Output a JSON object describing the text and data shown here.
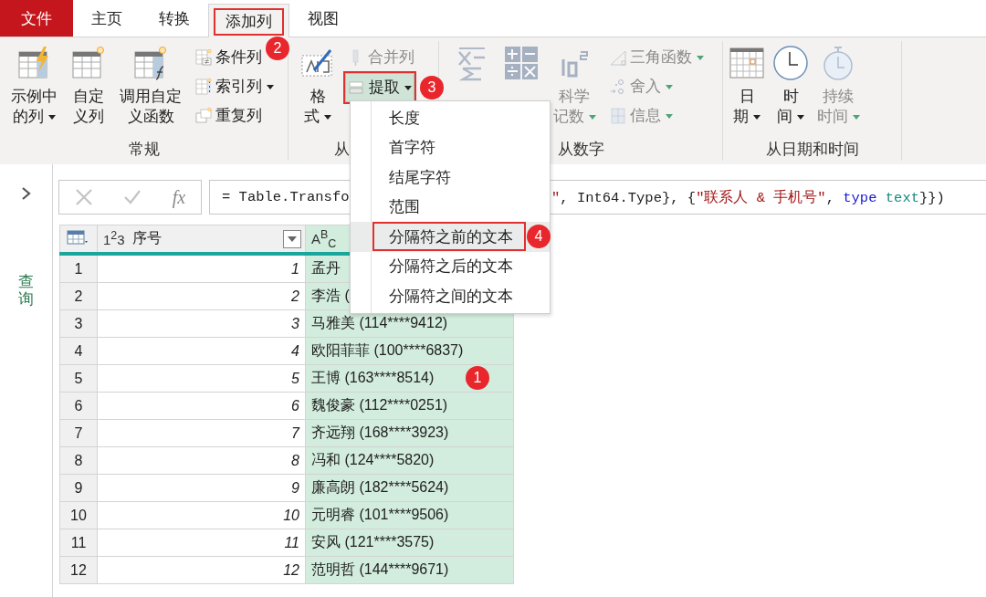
{
  "tabs": [
    {
      "label": "文件",
      "kind": "file",
      "selected": false
    },
    {
      "label": "主页",
      "kind": "tab",
      "selected": false
    },
    {
      "label": "转换",
      "kind": "tab",
      "selected": false
    },
    {
      "label": "添加列",
      "kind": "tab",
      "selected": true,
      "callout": "2"
    },
    {
      "label": "视图",
      "kind": "tab",
      "selected": false
    }
  ],
  "ribbon": {
    "groups": [
      {
        "label": "常规",
        "items": [
          {
            "kind": "large",
            "label": "示例中的列",
            "dropdown": true,
            "disabled": false,
            "expanded": false
          },
          {
            "kind": "large",
            "label": "自定义列",
            "dropdown": false,
            "disabled": false,
            "expanded": false
          },
          {
            "kind": "large",
            "label": "调用自定义函数",
            "dropdown": false,
            "disabled": false,
            "expanded": false
          },
          {
            "kind": "stack",
            "items": [
              {
                "label": "条件列",
                "dropdown": false,
                "disabled": false,
                "expanded": false
              },
              {
                "label": "索引列",
                "dropdown": true,
                "disabled": false,
                "expanded": false
              },
              {
                "label": "重复列",
                "dropdown": false,
                "disabled": false,
                "expanded": false
              }
            ]
          }
        ]
      },
      {
        "label": "从",
        "items": [
          {
            "kind": "large",
            "label": "格式",
            "dropdown": true,
            "disabled": false,
            "expanded": false
          },
          {
            "kind": "stack",
            "items": [
              {
                "label": "合并列",
                "dropdown": false,
                "disabled": true,
                "expanded": false
              },
              {
                "label": "提取",
                "dropdown": true,
                "disabled": false,
                "expanded": true,
                "callout": "3"
              }
            ]
          }
        ]
      },
      {
        "label": "从数字",
        "items": [
          {
            "kind": "large",
            "disabled": true,
            "expanded": false
          },
          {
            "kind": "large",
            "disabled": true,
            "expanded": false
          },
          {
            "kind": "large",
            "label": "科学记数",
            "dropdown": true,
            "disabled": true,
            "expanded": false
          },
          {
            "kind": "stack",
            "items": [
              {
                "label": "三角函数",
                "dropdown": true,
                "disabled": true,
                "expanded": false
              },
              {
                "label": "舍入",
                "dropdown": true,
                "disabled": true,
                "expanded": false
              },
              {
                "label": "信息",
                "dropdown": true,
                "disabled": true,
                "expanded": false
              }
            ]
          }
        ]
      },
      {
        "label": "从日期和时间",
        "items": [
          {
            "kind": "large",
            "label": "日期",
            "dropdown": true,
            "disabled": false,
            "expanded": false
          },
          {
            "kind": "large",
            "label": "时间",
            "dropdown": true,
            "disabled": false,
            "expanded": false
          },
          {
            "kind": "large",
            "label": "持续时间",
            "dropdown": true,
            "disabled": true,
            "expanded": false
          }
        ]
      }
    ]
  },
  "sidebar": {
    "label": "查询"
  },
  "formula_bar": {
    "fx": "fx",
    "before": [
      {
        "text": "= Table.Transfo",
        "kind": "plain"
      }
    ],
    "after": [
      {
        "text": "\"",
        "kind": "string"
      },
      {
        "text": ", Int64.Type}, {",
        "kind": "plain"
      },
      {
        "text": "\"联系人 & 手机号\"",
        "kind": "string"
      },
      {
        "text": ", ",
        "kind": "plain"
      },
      {
        "text": "type",
        "kind": "keyword"
      },
      {
        "text": " text",
        "kind": "typename"
      },
      {
        "text": "}})",
        "kind": "plain"
      }
    ]
  },
  "table": {
    "columns": [
      {
        "type": "1$^{2}$3",
        "label": "序号",
        "selected": false
      },
      {
        "type": "A$^{B}$$_{C}$",
        "selected": true
      }
    ],
    "rows": [
      {
        "number": "1",
        "id": "1",
        "name": "孟丹"
      },
      {
        "number": "2",
        "id": "2",
        "name": "李浩 ("
      },
      {
        "number": "3",
        "id": "3",
        "name": "马雅美 (114****9412)"
      },
      {
        "number": "4",
        "id": "4",
        "name": "欧阳菲菲 (100****6837)"
      },
      {
        "number": "5",
        "id": "5",
        "name": "王博 (163****8514)",
        "callout": "1"
      },
      {
        "number": "6",
        "id": "6",
        "name": "魏俊豪 (112****0251)"
      },
      {
        "number": "7",
        "id": "7",
        "name": "齐远翔 (168****3923)"
      },
      {
        "number": "8",
        "id": "8",
        "name": "冯和 (124****5820)"
      },
      {
        "number": "9",
        "id": "9",
        "name": "廉高朗 (182****5624)"
      },
      {
        "number": "10",
        "id": "10",
        "name": "元明睿 (101****9506)"
      },
      {
        "number": "11",
        "id": "11",
        "name": "安风 (121****3575)"
      },
      {
        "number": "12",
        "id": "12",
        "name": "范明哲 (144****9671)"
      }
    ]
  },
  "menu": {
    "items": [
      {
        "label": "长度",
        "selected": false
      },
      {
        "label": "首字符",
        "selected": false
      },
      {
        "label": "结尾字符",
        "selected": false
      },
      {
        "label": "范围",
        "selected": false
      },
      {
        "label": "分隔符之前的文本",
        "selected": true,
        "callout": "4"
      },
      {
        "label": "分隔符之后的文本",
        "selected": false
      },
      {
        "label": "分隔符之间的文本",
        "selected": false
      }
    ]
  }
}
